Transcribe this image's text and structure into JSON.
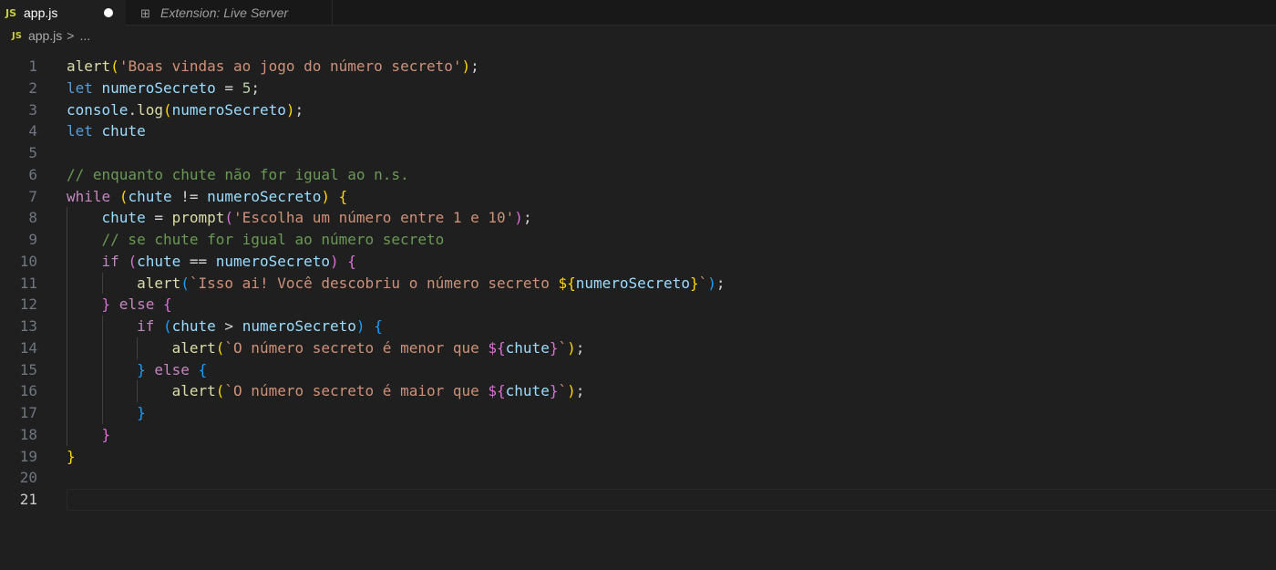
{
  "tabs": [
    {
      "label": "app.js",
      "icon": "js-icon",
      "modified": true
    },
    {
      "label": "Extension: Live Server",
      "icon": "extension-icon"
    }
  ],
  "breadcrumb": {
    "file": "app.js",
    "sep": ">",
    "more": "..."
  },
  "js_badge": "JS",
  "current_line": 21,
  "lines": [
    [
      [
        "f",
        "alert"
      ],
      [
        "b1",
        "("
      ],
      [
        "s",
        "'Boas vindas ao jogo do número secreto'"
      ],
      [
        "b1",
        ")"
      ],
      [
        "p",
        ";"
      ]
    ],
    [
      [
        "k",
        "let"
      ],
      [
        "p",
        " "
      ],
      [
        "v",
        "numeroSecreto"
      ],
      [
        "p",
        " = "
      ],
      [
        "n",
        "5"
      ],
      [
        "p",
        ";"
      ]
    ],
    [
      [
        "v",
        "console"
      ],
      [
        "p",
        "."
      ],
      [
        "f",
        "log"
      ],
      [
        "b1",
        "("
      ],
      [
        "v",
        "numeroSecreto"
      ],
      [
        "b1",
        ")"
      ],
      [
        "p",
        ";"
      ]
    ],
    [
      [
        "k",
        "let"
      ],
      [
        "p",
        " "
      ],
      [
        "v",
        "chute"
      ]
    ],
    [],
    [
      [
        "m",
        "// enquanto chute não for igual ao n.s."
      ]
    ],
    [
      [
        "c",
        "while"
      ],
      [
        "p",
        " "
      ],
      [
        "b1",
        "("
      ],
      [
        "v",
        "chute"
      ],
      [
        "p",
        " != "
      ],
      [
        "v",
        "numeroSecreto"
      ],
      [
        "b1",
        ")"
      ],
      [
        "p",
        " "
      ],
      [
        "b1",
        "{"
      ]
    ],
    [
      [
        "p",
        "    "
      ],
      [
        "v",
        "chute"
      ],
      [
        "p",
        " = "
      ],
      [
        "f",
        "prompt"
      ],
      [
        "b2",
        "("
      ],
      [
        "s",
        "'Escolha um número entre 1 e 10'"
      ],
      [
        "b2",
        ")"
      ],
      [
        "p",
        ";"
      ]
    ],
    [
      [
        "p",
        "    "
      ],
      [
        "m",
        "// se chute for igual ao número secreto"
      ]
    ],
    [
      [
        "p",
        "    "
      ],
      [
        "c",
        "if"
      ],
      [
        "p",
        " "
      ],
      [
        "b2",
        "("
      ],
      [
        "v",
        "chute"
      ],
      [
        "p",
        " == "
      ],
      [
        "v",
        "numeroSecreto"
      ],
      [
        "b2",
        ")"
      ],
      [
        "p",
        " "
      ],
      [
        "b2",
        "{"
      ]
    ],
    [
      [
        "p",
        "        "
      ],
      [
        "f",
        "alert"
      ],
      [
        "b3",
        "("
      ],
      [
        "s",
        "`Isso ai! Você descobriu o número secreto "
      ],
      [
        "b1",
        "${"
      ],
      [
        "v",
        "numeroSecreto"
      ],
      [
        "b1",
        "}"
      ],
      [
        "s",
        "`"
      ],
      [
        "b3",
        ")"
      ],
      [
        "p",
        ";"
      ]
    ],
    [
      [
        "p",
        "    "
      ],
      [
        "b2",
        "}"
      ],
      [
        "c",
        " else "
      ],
      [
        "b2",
        "{"
      ]
    ],
    [
      [
        "p",
        "        "
      ],
      [
        "c",
        "if"
      ],
      [
        "p",
        " "
      ],
      [
        "b3",
        "("
      ],
      [
        "v",
        "chute"
      ],
      [
        "p",
        " > "
      ],
      [
        "v",
        "numeroSecreto"
      ],
      [
        "b3",
        ")"
      ],
      [
        "p",
        " "
      ],
      [
        "b3",
        "{"
      ]
    ],
    [
      [
        "p",
        "            "
      ],
      [
        "f",
        "alert"
      ],
      [
        "b1",
        "("
      ],
      [
        "s",
        "`O número secreto é menor que "
      ],
      [
        "b2",
        "${"
      ],
      [
        "v",
        "chute"
      ],
      [
        "b2",
        "}"
      ],
      [
        "s",
        "`"
      ],
      [
        "b1",
        ")"
      ],
      [
        "p",
        ";"
      ]
    ],
    [
      [
        "p",
        "        "
      ],
      [
        "b3",
        "}"
      ],
      [
        "c",
        " else "
      ],
      [
        "b3",
        "{"
      ]
    ],
    [
      [
        "p",
        "            "
      ],
      [
        "f",
        "alert"
      ],
      [
        "b1",
        "("
      ],
      [
        "s",
        "`O número secreto é maior que "
      ],
      [
        "b2",
        "${"
      ],
      [
        "v",
        "chute"
      ],
      [
        "b2",
        "}"
      ],
      [
        "s",
        "`"
      ],
      [
        "b1",
        ")"
      ],
      [
        "p",
        ";"
      ]
    ],
    [
      [
        "p",
        "        "
      ],
      [
        "b3",
        "}"
      ]
    ],
    [
      [
        "p",
        "    "
      ],
      [
        "b2",
        "}"
      ]
    ],
    [
      [
        "b1",
        "}"
      ]
    ],
    [],
    []
  ]
}
